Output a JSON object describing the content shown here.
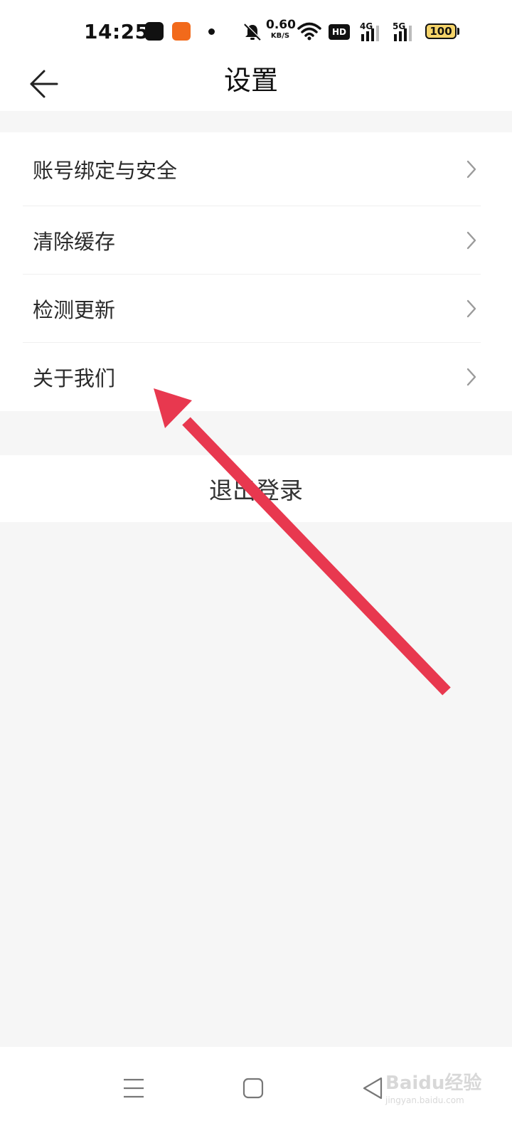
{
  "status_bar": {
    "time": "14:25",
    "net_speed_value": "0.60",
    "net_speed_unit": "KB/S",
    "hd_label": "HD",
    "sig1_label": "4G",
    "sig2_label": "5G",
    "battery": "100"
  },
  "header": {
    "title": "设置"
  },
  "menu": {
    "items": [
      {
        "label": "账号绑定与安全"
      },
      {
        "label": "清除缓存"
      },
      {
        "label": "检测更新"
      },
      {
        "label": "关于我们"
      }
    ]
  },
  "logout": {
    "label": "退出登录"
  },
  "annotation": {
    "arrow_color": "#e8384f"
  },
  "watermark": {
    "brand": "Baidu经验",
    "url": "jingyan.baidu.com"
  }
}
